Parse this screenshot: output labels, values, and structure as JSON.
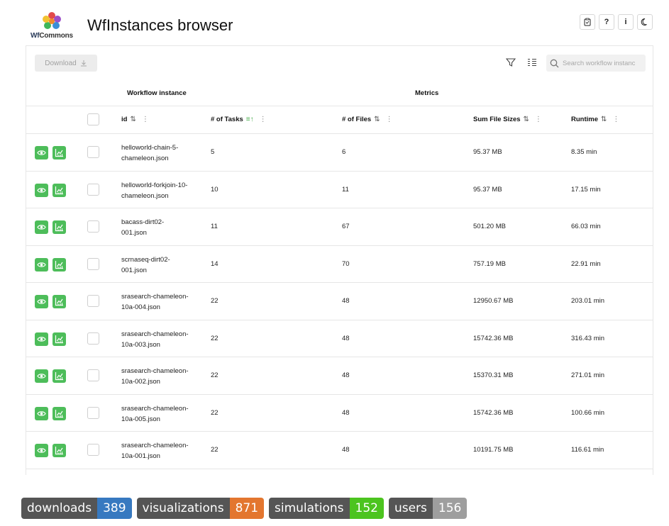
{
  "app": {
    "logo_text_prefix": "Wf",
    "logo_text_suffix": "Commons",
    "title": "WfInstances browser"
  },
  "top_buttons": [
    {
      "name": "clipboard-icon",
      "label": ""
    },
    {
      "name": "help-icon",
      "label": "?"
    },
    {
      "name": "info-icon",
      "label": "i"
    },
    {
      "name": "moon-icon",
      "label": ""
    }
  ],
  "toolbar": {
    "download_label": "Download",
    "search_placeholder": "Search workflow instanc"
  },
  "groups": {
    "instance": "Workflow instance",
    "metrics": "Metrics"
  },
  "columns": {
    "id": "id",
    "tasks": "# of Tasks",
    "files": "# of Files",
    "sizes": "Sum File Sizes",
    "runtime": "Runtime"
  },
  "rows": [
    {
      "id": "helloworld-chain-5-chameleon.json",
      "tasks": "5",
      "files": "6",
      "size": "95.37 MB",
      "runtime": "8.35 min"
    },
    {
      "id": "helloworld-forkjoin-10-chameleon.json",
      "tasks": "10",
      "files": "11",
      "size": "95.37 MB",
      "runtime": "17.15 min"
    },
    {
      "id": "bacass-dirt02-001.json",
      "tasks": "11",
      "files": "67",
      "size": "501.20 MB",
      "runtime": "66.03 min"
    },
    {
      "id": "scrnaseq-dirt02-001.json",
      "tasks": "14",
      "files": "70",
      "size": "757.19 MB",
      "runtime": "22.91 min"
    },
    {
      "id": "srasearch-chameleon-10a-004.json",
      "tasks": "22",
      "files": "48",
      "size": "12950.67 MB",
      "runtime": "203.01 min"
    },
    {
      "id": "srasearch-chameleon-10a-003.json",
      "tasks": "22",
      "files": "48",
      "size": "15742.36 MB",
      "runtime": "316.43 min"
    },
    {
      "id": "srasearch-chameleon-10a-002.json",
      "tasks": "22",
      "files": "48",
      "size": "15370.31 MB",
      "runtime": "271.01 min"
    },
    {
      "id": "srasearch-chameleon-10a-005.json",
      "tasks": "22",
      "files": "48",
      "size": "15742.36 MB",
      "runtime": "100.66 min"
    },
    {
      "id": "srasearch-chameleon-10a-001.json",
      "tasks": "22",
      "files": "48",
      "size": "10191.75 MB",
      "runtime": "116.61 min"
    }
  ],
  "row_id_lines": [
    [
      "helloworld-chain-5-",
      "chameleon.json"
    ],
    [
      "helloworld-forkjoin-10-",
      "chameleon.json"
    ],
    [
      "bacass-dirt02-",
      "001.json"
    ],
    [
      "scrnaseq-dirt02-",
      "001.json"
    ],
    [
      "srasearch-chameleon-",
      "10a-004.json"
    ],
    [
      "srasearch-chameleon-",
      "10a-003.json"
    ],
    [
      "srasearch-chameleon-",
      "10a-002.json"
    ],
    [
      "srasearch-chameleon-",
      "10a-005.json"
    ],
    [
      "srasearch-chameleon-",
      "10a-001.json"
    ]
  ],
  "badges": [
    {
      "key": "downloads",
      "value": "389",
      "color": "#3779c0"
    },
    {
      "key": "visualizations",
      "value": "871",
      "color": "#e3762f"
    },
    {
      "key": "simulations",
      "value": "152",
      "color": "#4cc41f"
    },
    {
      "key": "users",
      "value": "156",
      "color": "#9e9e9e"
    }
  ],
  "colors": {
    "action_green": "#4dbd5a",
    "sort_active": "#4caf50"
  }
}
